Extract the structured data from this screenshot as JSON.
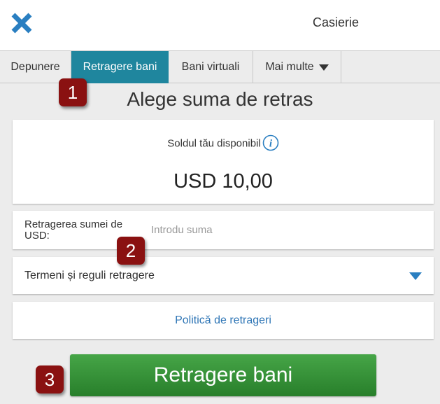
{
  "header": {
    "title": "Casierie",
    "close_icon": "close-x-icon",
    "accent_color": "#2a7fc1"
  },
  "tabs": [
    {
      "label": "Depunere",
      "active": false
    },
    {
      "label": "Retragere bani",
      "active": true
    },
    {
      "label": "Bani virtuali",
      "active": false
    },
    {
      "label": "Mai multe",
      "active": false,
      "icon": "caret-down-icon"
    }
  ],
  "main": {
    "title": "Alege suma de retras",
    "balance": {
      "label": "Soldul tău disponibil",
      "info_icon": "info-icon",
      "value": "USD 10,00"
    },
    "amount": {
      "label": "Retragerea sumei de USD:",
      "placeholder": "Introdu suma",
      "value": ""
    },
    "terms": {
      "label": "Termeni și reguli retragere",
      "icon": "caret-down-icon"
    },
    "policy_link": "Politică de retrageri",
    "submit_label": "Retragere bani"
  },
  "annotations": {
    "badges": [
      "1",
      "2",
      "3"
    ],
    "badge_color": "#8a1111"
  },
  "colors": {
    "active_tab": "#1f869e",
    "submit_button": "#36913a",
    "link": "#2f76b6"
  }
}
